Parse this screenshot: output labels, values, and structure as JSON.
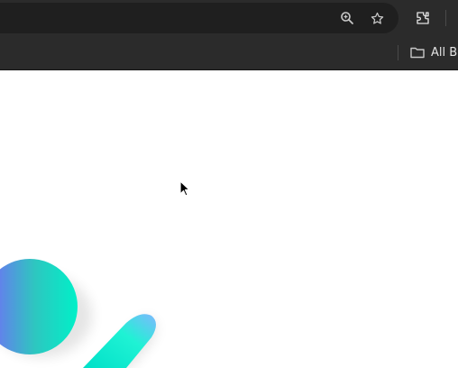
{
  "toolbar": {
    "icons": [
      "zoom-icon",
      "bookmark-star-icon",
      "extensions-icon"
    ]
  },
  "bookmarks_bar": {
    "items": [
      {
        "label": "All B",
        "icon": "folder-icon"
      }
    ]
  },
  "page": {
    "decorations": [
      "gradient-circle",
      "gradient-pill"
    ],
    "colors": {
      "gradient_start": "#7b61ff",
      "gradient_end": "#00f0c8"
    }
  }
}
